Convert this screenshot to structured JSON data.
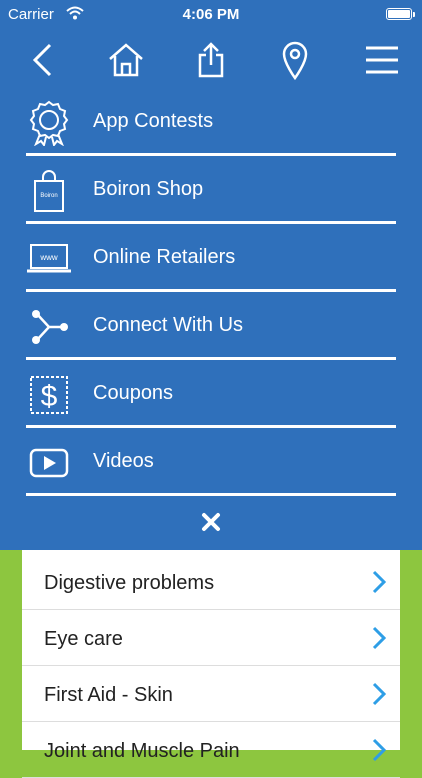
{
  "status_bar": {
    "carrier": "Carrier",
    "time": "4:06 PM"
  },
  "nav": {
    "icons": [
      "back-icon",
      "home-icon",
      "share-icon",
      "location-pin-icon",
      "hamburger-menu-icon"
    ]
  },
  "menu": {
    "items": [
      {
        "label": "App Contests",
        "icon": "award-ribbon-icon"
      },
      {
        "label": "Boiron Shop",
        "icon": "shopping-bag-icon"
      },
      {
        "label": "Online Retailers",
        "icon": "laptop-www-icon"
      },
      {
        "label": "Connect With Us",
        "icon": "share-nodes-icon"
      },
      {
        "label": "Coupons",
        "icon": "coupon-dollar-icon"
      },
      {
        "label": "Videos",
        "icon": "play-button-icon"
      }
    ],
    "close_symbol": "✕",
    "shop_bag_text": "Boiron"
  },
  "list": {
    "items": [
      {
        "label": "Digestive problems"
      },
      {
        "label": "Eye care"
      },
      {
        "label": "First Aid - Skin"
      },
      {
        "label": "Joint and Muscle Pain"
      }
    ]
  },
  "colors": {
    "header_blue": "#2f70bb",
    "side_green": "#8dc63f",
    "chevron_blue": "#2e9ee6"
  }
}
